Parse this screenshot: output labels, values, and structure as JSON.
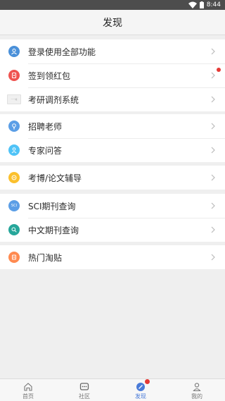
{
  "status_bar": {
    "time": "8:44"
  },
  "header": {
    "title": "发现"
  },
  "groups": [
    {
      "items": [
        {
          "label": "登录使用全部功能",
          "icon": "user-icon",
          "color": "#4a90d9"
        },
        {
          "label": "签到领红包",
          "icon": "red-packet-icon",
          "color": "#ef5350",
          "badge": true
        },
        {
          "label": "考研调剂系统",
          "icon": "adjust-system-logo",
          "color": "#f0f0f0",
          "logo_text": "一一峰"
        }
      ]
    },
    {
      "items": [
        {
          "label": "招聘老师",
          "icon": "bulb-icon",
          "color": "#5b9ee6"
        },
        {
          "label": "专家问答",
          "icon": "expert-icon",
          "color": "#4fc3f7"
        }
      ]
    },
    {
      "items": [
        {
          "label": "考博/论文辅导",
          "icon": "coin-icon",
          "color": "#fbc02d"
        }
      ]
    },
    {
      "items": [
        {
          "label": "SCI期刊查询",
          "icon": "sci-icon",
          "color": "#5b9ee6",
          "icon_text": "SCI"
        },
        {
          "label": "中文期刊查询",
          "icon": "search-icon",
          "color": "#26a69a"
        }
      ]
    },
    {
      "items": [
        {
          "label": "热门淘贴",
          "icon": "hot-posts-icon",
          "color": "#ff8a50"
        }
      ]
    }
  ],
  "tabs": [
    {
      "label": "首页",
      "icon": "home-icon"
    },
    {
      "label": "社区",
      "icon": "chat-icon"
    },
    {
      "label": "发现",
      "icon": "discover-icon",
      "active": true,
      "badge": true
    },
    {
      "label": "我的",
      "icon": "profile-icon"
    }
  ],
  "colors": {
    "accent": "#4a7bd8",
    "badge": "#e53935",
    "status_bar": "#4d4d4d"
  }
}
